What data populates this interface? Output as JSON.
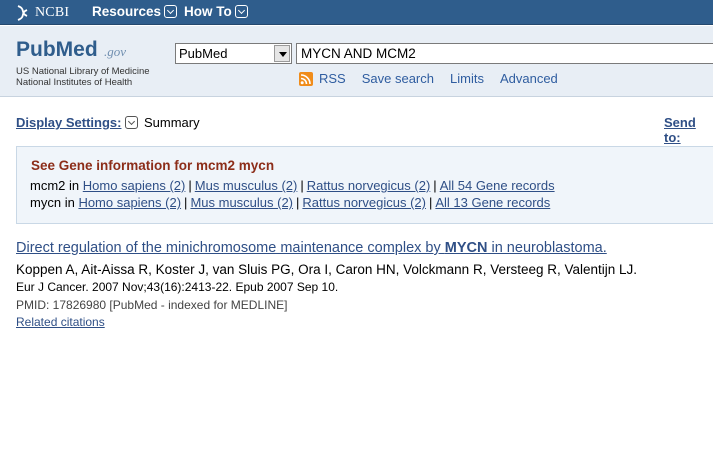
{
  "topbar": {
    "logo_text": "NCBI",
    "resources_label": "Resources",
    "howto_label": "How To"
  },
  "header": {
    "logo_pub": "PubMed",
    "logo_gov": ".gov",
    "nlm_line1": "US National Library of Medicine",
    "nlm_line2": "National Institutes of Health",
    "database_selected": "PubMed",
    "search_value": "MYCN AND MCM2",
    "links": {
      "rss": "RSS",
      "save_search": "Save search",
      "limits": "Limits",
      "advanced": "Advanced"
    }
  },
  "display": {
    "settings_label": "Display Settings:",
    "format": "Summary",
    "send_to": "Send to:"
  },
  "gene_info": {
    "title": "See Gene information for mcm2 mycn",
    "rows": [
      {
        "gene": "mcm2",
        "in": "in",
        "links": [
          "Homo sapiens (2)",
          "Mus musculus (2)",
          "Rattus norvegicus (2)",
          "All 54 Gene records"
        ]
      },
      {
        "gene": "mycn",
        "in": "in",
        "links": [
          "Homo sapiens (2)",
          "Mus musculus (2)",
          "Rattus norvegicus (2)",
          "All 13 Gene records"
        ]
      }
    ]
  },
  "result": {
    "title_before": "Direct regulation of the minichromosome maintenance complex by ",
    "title_bold": "MYCN",
    "title_after": " in neuroblastoma.",
    "authors": "Koppen A, Ait-Aissa R, Koster J, van Sluis PG, Ora I, Caron HN, Volckmann R, Versteeg R, Valentijn LJ.",
    "journal": "Eur J Cancer. 2007 Nov;43(16):2413-22. Epub 2007 Sep 10.",
    "pmid": "PMID: 17826980 [PubMed - indexed for MEDLINE]",
    "related": "Related citations"
  },
  "colors": {
    "topbar": "#2f5d8c",
    "header_bg": "#e8eef5",
    "link": "#2f4f86",
    "gene_title": "#8c2d19",
    "gene_box_bg": "#f0f5fa",
    "rss_orange": "#f08c1a"
  }
}
